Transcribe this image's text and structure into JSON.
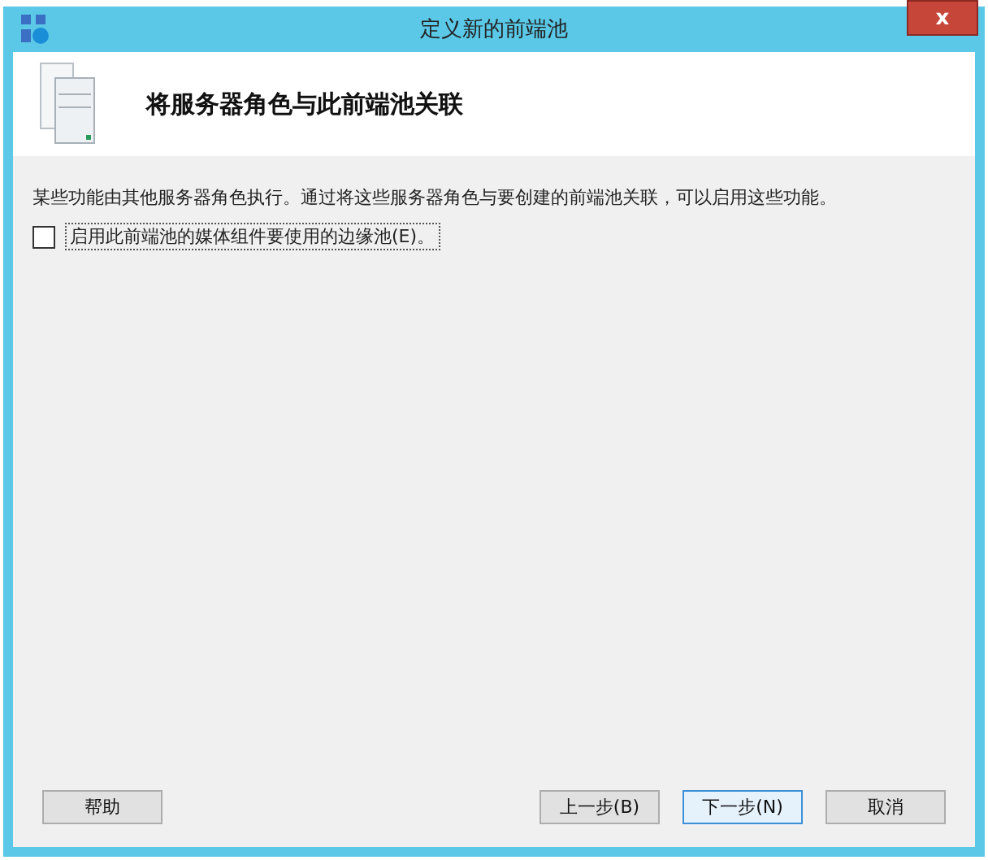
{
  "window": {
    "title": "定义新的前端池",
    "close": "x"
  },
  "header": {
    "title": "将服务器角色与此前端池关联"
  },
  "description": "某些功能由其他服务器角色执行。通过将这些服务器角色与要创建的前端池关联，可以启用这些功能。",
  "options": [
    {
      "label": "启用此前端池的媒体组件要使用的边缘池(E)。",
      "checked": false
    }
  ],
  "help_button": "帮助",
  "buttons": [
    {
      "label": "上一步(B)",
      "default": false
    },
    {
      "label": "下一步(N)",
      "default": true
    },
    {
      "label": "取消",
      "default": false
    }
  ]
}
